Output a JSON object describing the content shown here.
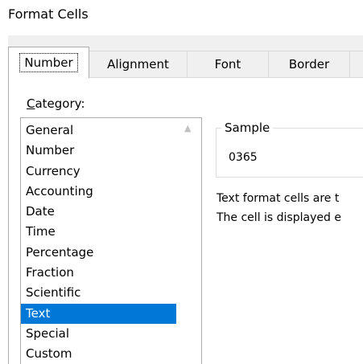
{
  "window": {
    "title": "Format Cells"
  },
  "tabs": [
    {
      "label": "Number",
      "active": true
    },
    {
      "label": "Alignment",
      "active": false
    },
    {
      "label": "Font",
      "active": false
    },
    {
      "label": "Border",
      "active": false
    }
  ],
  "category": {
    "label_accel": "C",
    "label_rest": "ategory:",
    "items": [
      "General",
      "Number",
      "Currency",
      "Accounting",
      "Date",
      "Time",
      "Percentage",
      "Fraction",
      "Scientific",
      "Text",
      "Special",
      "Custom"
    ],
    "selected": "Text"
  },
  "sample": {
    "legend": "Sample",
    "value": "0365"
  },
  "description": {
    "line1": "Text format cells are t",
    "line2": "The cell is displayed e"
  },
  "colors": {
    "selection": "#0078d7",
    "tabstrip": "#f0f0f0"
  },
  "icons": {
    "scroll_up": "chevron-up-icon"
  }
}
